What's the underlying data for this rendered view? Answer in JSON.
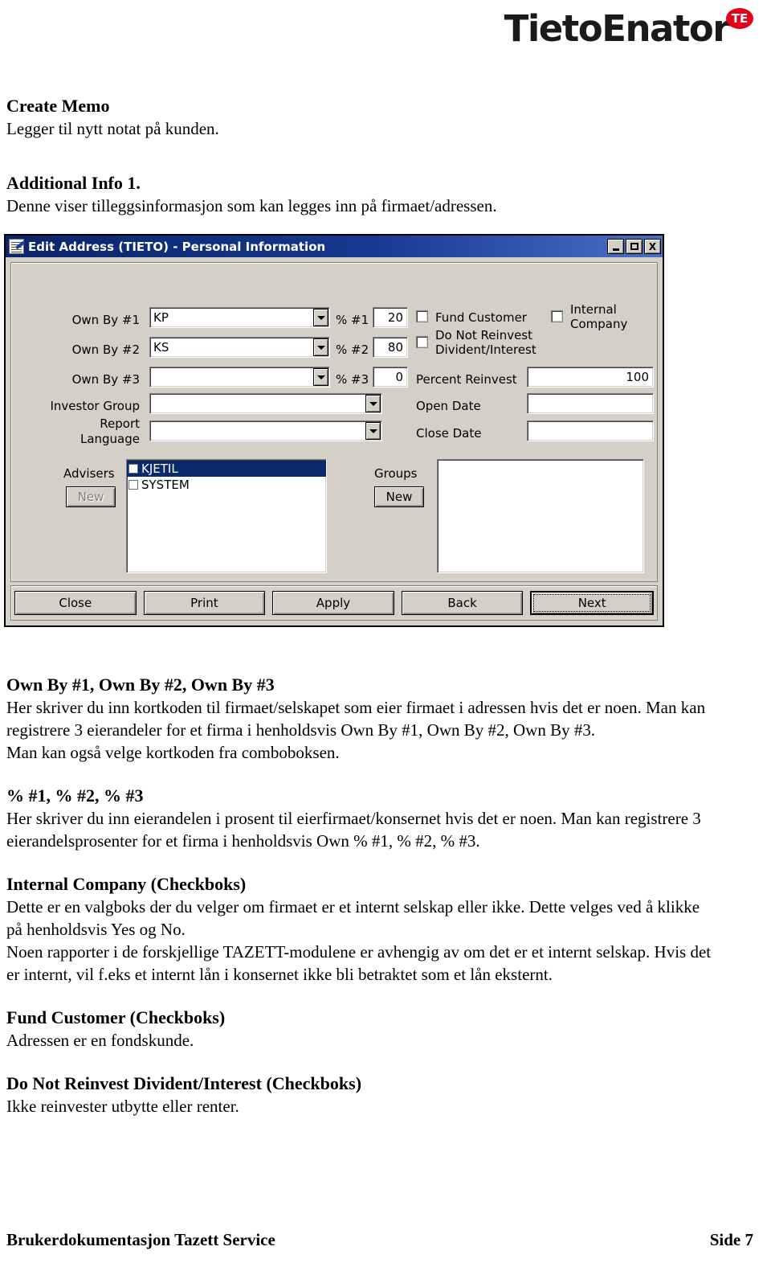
{
  "brand": {
    "name": "TietoEnator",
    "badge": "TE",
    "badge_color": "#e2001a"
  },
  "doc": {
    "sections": [
      {
        "heading": "Create Memo",
        "body": "Legger til nytt notat på kunden."
      },
      {
        "heading": "Additional Info 1.",
        "body": "Denne viser tilleggsinformasjon som kan legges inn på firmaet/adressen."
      }
    ],
    "after_image_sections": [
      {
        "heading": "Own By #1, Own By #2, Own By #3",
        "body": "Her skriver du inn kortkoden til firmaet/selskapet som eier firmaet i adressen hvis det er noen. Man kan registrere 3 eierandeler for et firma i henholdsvis Own By #1, Own By #2, Own By #3.",
        "body2": "Man kan også velge kortkoden fra comboboksen."
      },
      {
        "heading": "% #1, % #2, % #3",
        "body": "Her skriver du inn eierandelen i prosent til eierfirmaet/konsernet hvis det er noen. Man kan registrere 3 eierandelsprosenter for et firma i henholdsvis Own % #1, % #2, % #3."
      },
      {
        "heading": "Internal Company (Checkboks)",
        "body": "Dette er en valgboks der du velger om firmaet er et internt selskap eller ikke. Dette velges ved å klikke på henholdsvis Yes og No.",
        "body2": "Noen rapporter i de forskjellige TAZETT-modulene er avhengig av om det er et internt selskap. Hvis det er internt, vil f.eks et internt lån i konsernet ikke bli betraktet som et lån eksternt."
      },
      {
        "heading": "Fund Customer (Checkboks)",
        "body": "Adressen er en fondskunde."
      },
      {
        "heading": "Do Not Reinvest Divident/Interest (Checkboks)",
        "body": "Ikke reinvester utbytte eller renter."
      }
    ]
  },
  "dialog": {
    "title": "Edit Address (TIETO) - Personal Information",
    "title_bar_color": "#0a246a",
    "window_controls": {
      "minimize": "_",
      "maximize": "□",
      "close": "X"
    },
    "fields": {
      "own_by_1_label": "Own By #1",
      "own_by_1_value": "KP",
      "own_by_2_label": "Own By #2",
      "own_by_2_value": "KS",
      "own_by_3_label": "Own By #3",
      "own_by_3_value": "",
      "pct_1_label": "% #1",
      "pct_1_value": "20",
      "pct_2_label": "% #2",
      "pct_2_value": "80",
      "pct_3_label": "% #3",
      "pct_3_value": "0",
      "investor_group_label": "Investor Group",
      "investor_group_value": "",
      "report_language_label_1": "Report",
      "report_language_label_2": "Language",
      "report_language_value": "",
      "percent_reinvest_label": "Percent Reinvest",
      "percent_reinvest_value": "100",
      "open_date_label": "Open Date",
      "open_date_value": "",
      "close_date_label": "Close Date",
      "close_date_value": ""
    },
    "checkboxes": [
      {
        "label": "Fund Customer",
        "checked": false
      },
      {
        "label_1": "Do Not Reinvest",
        "label_2": "Divident/Interest",
        "checked": false
      },
      {
        "label_1": "Internal",
        "label_2": "Company",
        "checked": false
      }
    ],
    "advisers": {
      "label": "Advisers",
      "new_button": "New",
      "new_enabled": false,
      "items": [
        {
          "label": "KJETIL",
          "selected": true,
          "checked": false
        },
        {
          "label": "SYSTEM",
          "selected": false,
          "checked": false
        }
      ]
    },
    "groups": {
      "label": "Groups",
      "new_button": "New",
      "new_enabled": true,
      "items": []
    },
    "buttons": [
      {
        "label": "Close",
        "focused": false
      },
      {
        "label": "Print",
        "focused": false
      },
      {
        "label": "Apply",
        "focused": false
      },
      {
        "label": "Back",
        "focused": false
      },
      {
        "label": "Next",
        "focused": true
      }
    ]
  },
  "footer": {
    "left": "Brukerdokumentasjon Tazett Service",
    "right": "Side 7"
  }
}
